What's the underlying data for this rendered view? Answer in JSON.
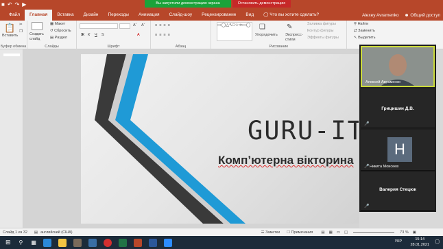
{
  "qat": {
    "save_icon": "save-icon",
    "undo_icon": "undo-icon",
    "redo_icon": "redo-icon",
    "present_icon": "present-icon"
  },
  "banners": {
    "sharing": "Вы запустили демонстрацию экрана",
    "stop": "Остановить демонстрацию"
  },
  "tabs": [
    "Файл",
    "Главная",
    "Вставка",
    "Дизайн",
    "Переходы",
    "Анимация",
    "Слайд-шоу",
    "Рецензирование",
    "Вид"
  ],
  "active_tab": "Главная",
  "tell_me": "Что вы хотите сделать?",
  "user": {
    "name": "Alexey Avramenko",
    "share": "Общий доступ"
  },
  "ribbon": {
    "clipboard": {
      "paste": "Вставить",
      "label": "Буфер обмена"
    },
    "slides": {
      "new": "Создать слайд",
      "layout": "Макет",
      "reset": "Сбросить",
      "section": "Раздел",
      "label": "Слайды"
    },
    "font": {
      "bold": "Ж",
      "italic": "К",
      "underline": "Ч",
      "strike": "S",
      "label": "Шрифт"
    },
    "paragraph": {
      "label": "Абзац"
    },
    "drawing": {
      "arrange": "Упорядочить",
      "quick_styles": "Экспресс-стили",
      "fill": "Заливка фигуры",
      "outline": "Контур фигуры",
      "effects": "Эффекты фигуры",
      "label": "Рисование"
    },
    "editing": {
      "find": "Найти",
      "replace": "Заменить",
      "select": "Выделить",
      "label": "Реда"
    }
  },
  "slide": {
    "title": "GURU-IT",
    "subtitle": "Комп’ютерна вікторина"
  },
  "participants": [
    {
      "name": "Алексей Авраменко",
      "type": "video"
    },
    {
      "name": "Грицишин Д.В.",
      "type": "name"
    },
    {
      "name": "Никита Моисеев",
      "type": "avatar",
      "initial": "Н"
    },
    {
      "name": "Валерия Стецюк",
      "type": "name"
    }
  ],
  "status": {
    "slide": "Слайд 1 из 32",
    "lang": "английский (США)",
    "notes": "Заметки",
    "comments": "Примечания",
    "zoom": "73 %"
  },
  "taskbar": {
    "lang": "УКР",
    "time": "15:14",
    "date": "28.01.2021"
  },
  "colors": {
    "accent": "#b7472a",
    "share_green": "#1aa33a",
    "stop_red": "#c62828"
  }
}
